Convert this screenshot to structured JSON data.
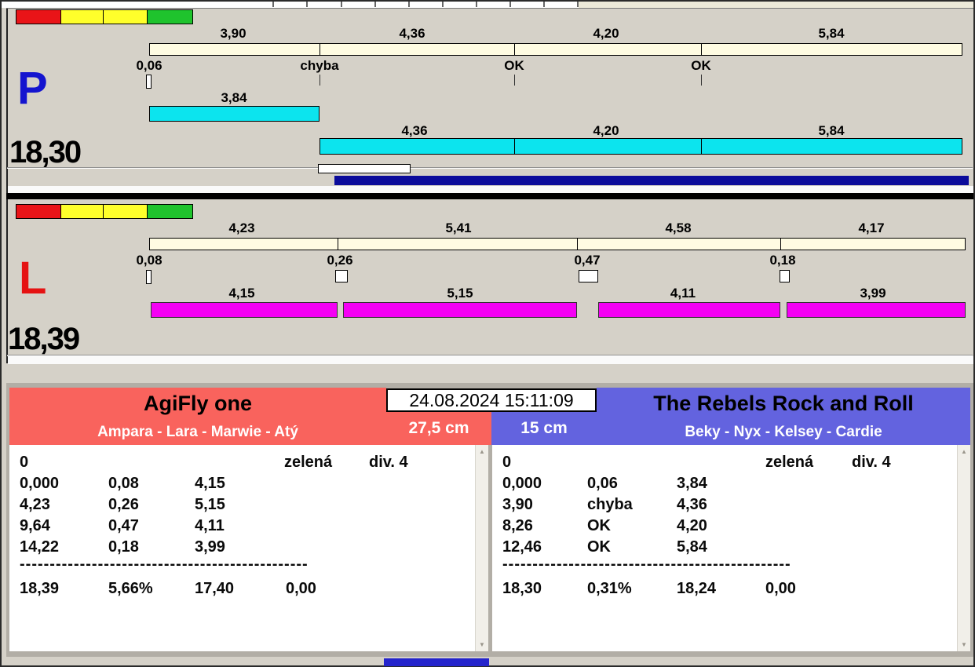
{
  "colors": {
    "progress_cyan": "#0ce4ee",
    "progress_magenta": "#f400f4",
    "ruler_cream": "#fffce2",
    "underline_navy": "#0b0b9b",
    "team_left_red": "#f9635d",
    "team_right_blue": "#6363df"
  },
  "top_panel": {
    "lane_letter": "P",
    "total_time": "18,30",
    "split_labels": [
      "3,90",
      "4,36",
      "4,20",
      "5,84"
    ],
    "gate_results": [
      "0,06",
      "chyba",
      "OK",
      "OK"
    ],
    "first_bar_label": "3,84",
    "run_bar_labels": [
      "4,36",
      "4,20",
      "5,84"
    ]
  },
  "bottom_panel": {
    "lane_letter": "L",
    "total_time": "18,39",
    "split_labels": [
      "4,23",
      "5,41",
      "4,58",
      "4,17"
    ],
    "gate_results": [
      "0,08",
      "0,26",
      "0,47",
      "0,18"
    ],
    "bar_labels": [
      "4,15",
      "5,15",
      "4,11",
      "3,99"
    ]
  },
  "scoreboard": {
    "clock": "24.08.2024 15:11:09",
    "left": {
      "team": "AgiFly one",
      "members": "Ampara - Lara - Marwie - Atý",
      "category": "27,5 cm",
      "info_row": {
        "start": "0",
        "color": "zelená",
        "division": "div. 4"
      },
      "rows": [
        [
          "0,000",
          "0,08",
          "4,15"
        ],
        [
          "4,23",
          "0,26",
          "5,15"
        ],
        [
          "9,64",
          "0,47",
          "4,11"
        ],
        [
          "14,22",
          "0,18",
          "3,99"
        ]
      ],
      "separator": "------------------------------------------------",
      "totals": [
        "18,39",
        "5,66%",
        "17,40",
        "0,00"
      ]
    },
    "right": {
      "team": "The Rebels Rock and Roll",
      "members": "Beky - Nyx - Kelsey - Cardie",
      "category": "15 cm",
      "info_row": {
        "start": "0",
        "color": "zelená",
        "division": "div. 4"
      },
      "rows": [
        [
          "0,000",
          "0,06",
          "3,84"
        ],
        [
          "3,90",
          "chyba",
          "4,36"
        ],
        [
          "8,26",
          "OK",
          "4,20"
        ],
        [
          "12,46",
          "OK",
          "5,84"
        ]
      ],
      "separator": "------------------------------------------------",
      "totals": [
        "18,30",
        "0,31%",
        "18,24",
        "0,00"
      ]
    }
  }
}
